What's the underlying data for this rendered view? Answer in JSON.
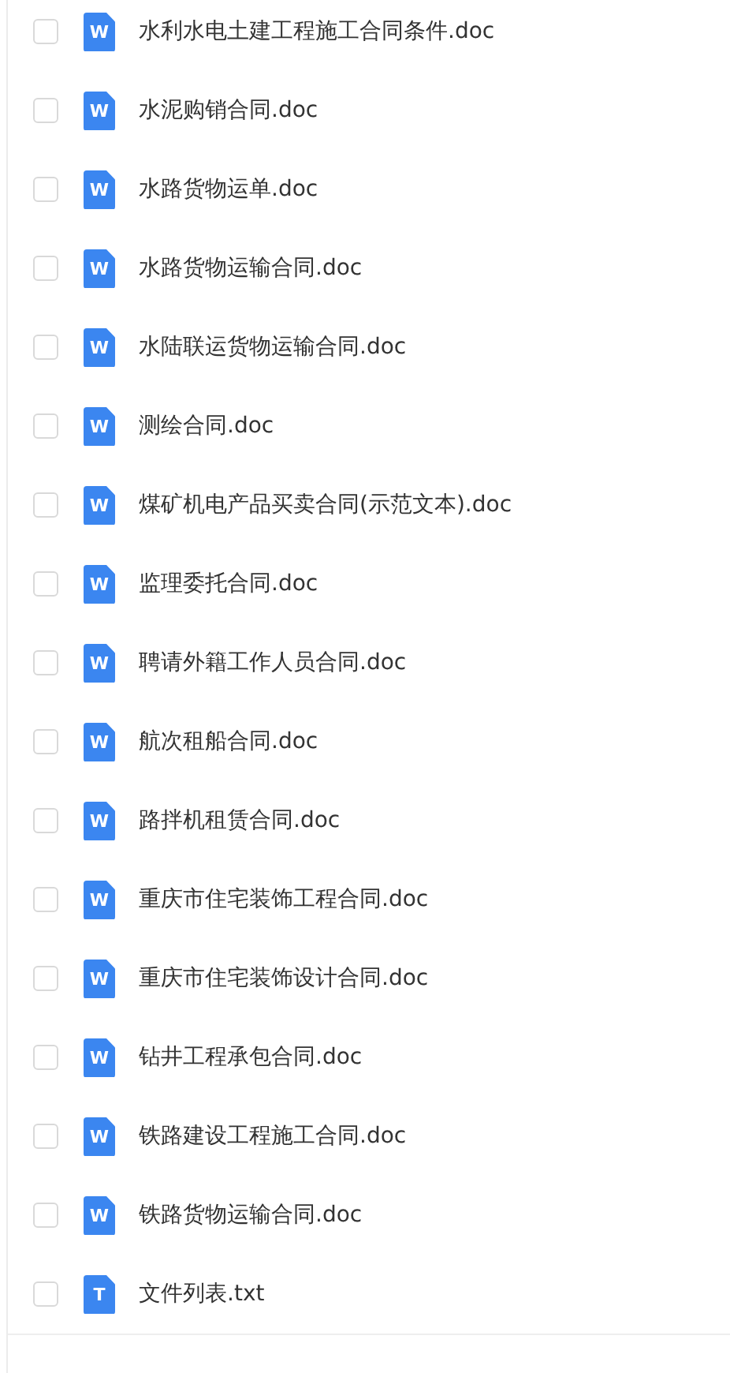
{
  "files": [
    {
      "name": "水利水电土建工程施工合同条件.doc",
      "badge": "W",
      "checked": false
    },
    {
      "name": "水泥购销合同.doc",
      "badge": "W",
      "checked": false
    },
    {
      "name": "水路货物运单.doc",
      "badge": "W",
      "checked": false
    },
    {
      "name": "水路货物运输合同.doc",
      "badge": "W",
      "checked": false
    },
    {
      "name": "水陆联运货物运输合同.doc",
      "badge": "W",
      "checked": false
    },
    {
      "name": "测绘合同.doc",
      "badge": "W",
      "checked": false
    },
    {
      "name": "煤矿机电产品买卖合同(示范文本).doc",
      "badge": "W",
      "checked": false
    },
    {
      "name": "监理委托合同.doc",
      "badge": "W",
      "checked": false
    },
    {
      "name": "聘请外籍工作人员合同.doc",
      "badge": "W",
      "checked": false
    },
    {
      "name": "航次租船合同.doc",
      "badge": "W",
      "checked": false
    },
    {
      "name": "路拌机租赁合同.doc",
      "badge": "W",
      "checked": false
    },
    {
      "name": "重庆市住宅装饰工程合同.doc",
      "badge": "W",
      "checked": false
    },
    {
      "name": "重庆市住宅装饰设计合同.doc",
      "badge": "W",
      "checked": false
    },
    {
      "name": "钻井工程承包合同.doc",
      "badge": "W",
      "checked": false
    },
    {
      "name": "铁路建设工程施工合同.doc",
      "badge": "W",
      "checked": false
    },
    {
      "name": "铁路货物运输合同.doc",
      "badge": "W",
      "checked": false
    },
    {
      "name": "文件列表.txt",
      "badge": "T",
      "checked": false
    }
  ]
}
